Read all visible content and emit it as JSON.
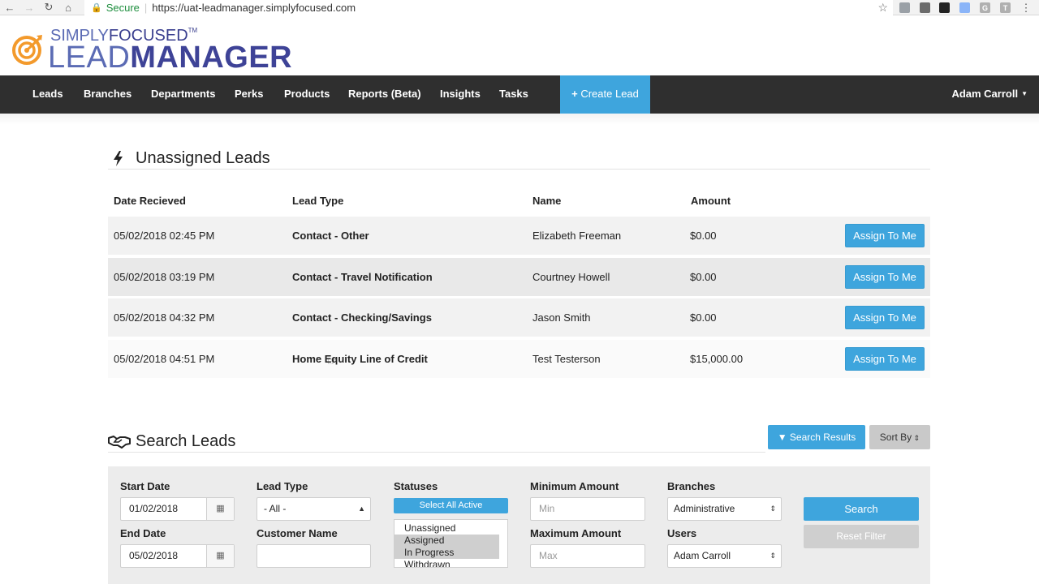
{
  "browser": {
    "secure_label": "Secure",
    "url": "https://uat-leadmanager.simplyfocused.com",
    "extensions": [
      {
        "name": "ext-1",
        "color": "#9aa0a6",
        "glyph": ""
      },
      {
        "name": "ext-2",
        "color": "#6b6b6b",
        "glyph": ""
      },
      {
        "name": "ext-3",
        "color": "#222222",
        "glyph": ""
      },
      {
        "name": "ext-4",
        "color": "#8ab4f8",
        "glyph": ""
      },
      {
        "name": "ext-5",
        "color": "#b0b0b0",
        "glyph": "G"
      },
      {
        "name": "ext-6",
        "color": "#b0b0b0",
        "glyph": "T"
      }
    ]
  },
  "logo": {
    "simply": "SIMPLY",
    "focused": "FOCUSED",
    "tm": "TM",
    "lead": "LEAD",
    "manager": "MANAGER"
  },
  "nav": {
    "items": [
      "Leads",
      "Branches",
      "Departments",
      "Perks",
      "Products",
      "Reports (Beta)",
      "Insights",
      "Tasks"
    ],
    "create_label": "Create Lead",
    "user_label": "Adam Carroll"
  },
  "unassigned": {
    "title": "Unassigned Leads",
    "columns": [
      "Date Recieved",
      "Lead Type",
      "Name",
      "Amount"
    ],
    "action_label": "Assign To Me",
    "rows": [
      {
        "date": "05/02/2018 02:45 PM",
        "type": "Contact - Other",
        "name": "Elizabeth Freeman",
        "amount": "$0.00"
      },
      {
        "date": "05/02/2018 03:19 PM",
        "type": "Contact - Travel Notification",
        "name": "Courtney Howell",
        "amount": "$0.00"
      },
      {
        "date": "05/02/2018 04:32 PM",
        "type": "Contact - Checking/Savings",
        "name": "Jason Smith",
        "amount": "$0.00"
      },
      {
        "date": "05/02/2018 04:51 PM",
        "type": "Home Equity Line of Credit",
        "name": "Test Testerson",
        "amount": "$15,000.00"
      }
    ]
  },
  "search": {
    "title": "Search Leads",
    "results_label": "Search Results",
    "sort_label": "Sort By",
    "start_date_label": "Start Date",
    "start_date_value": "01/02/2018",
    "end_date_label": "End Date",
    "end_date_value": "05/02/2018",
    "lead_type_label": "Lead Type",
    "lead_type_value": "- All -",
    "customer_name_label": "Customer Name",
    "customer_name_value": "",
    "statuses_label": "Statuses",
    "select_all_label": "Select All Active",
    "statuses": [
      {
        "label": "Unassigned",
        "selected": false
      },
      {
        "label": "Assigned",
        "selected": true
      },
      {
        "label": "In Progress",
        "selected": true
      },
      {
        "label": "Withdrawn",
        "selected": false
      }
    ],
    "min_amount_label": "Minimum Amount",
    "min_amount_placeholder": "Min",
    "max_amount_label": "Maximum Amount",
    "max_amount_placeholder": "Max",
    "branches_label": "Branches",
    "branches_value": "Administrative",
    "users_label": "Users",
    "users_value": "Adam Carroll",
    "search_button": "Search",
    "reset_button": "Reset Filter"
  },
  "colors": {
    "accent": "#3ea5dd",
    "navbar": "#2f2f2f",
    "logo_orange": "#f39a2c",
    "logo_blue": "#3e4397"
  }
}
